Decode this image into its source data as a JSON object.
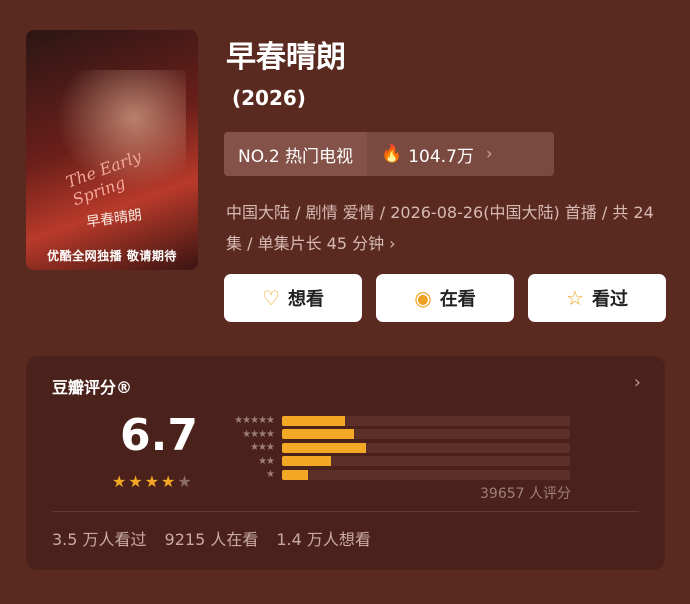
{
  "title": "早春晴朗",
  "year": "(2026)",
  "poster": {
    "art_title": "早春晴朗",
    "art_en": "The Early Spring",
    "tagline": "优酷全网独播 敬请期待"
  },
  "rank": {
    "label": "NO.2 热门电视",
    "heat": "104.7万"
  },
  "meta_text": "中国大陆 / 剧情 爱情 / 2026-08-26(中国大陆) 首播 / 共 24 集 / 单集片长 45 分钟 ›",
  "buttons": [
    {
      "label": "想看",
      "icon": "heart-plus-icon"
    },
    {
      "label": "在看",
      "icon": "target-icon"
    },
    {
      "label": "看过",
      "icon": "star-outline-icon"
    }
  ],
  "rating": {
    "header": "豆瓣评分®",
    "score": "6.7",
    "stars_value": 3.5,
    "distribution": [
      {
        "stars": "★★★★★",
        "fraction": 0.22
      },
      {
        "stars": "★★★★",
        "fraction": 0.25
      },
      {
        "stars": "★★★",
        "fraction": 0.29
      },
      {
        "stars": "★★",
        "fraction": 0.17
      },
      {
        "stars": "★",
        "fraction": 0.09
      }
    ],
    "count": "39657 人评分",
    "stats": [
      "3.5 万人看过",
      "9215 人在看",
      "1.4 万人想看"
    ]
  },
  "colors": {
    "accent": "#f3a926",
    "background": "#5a2a20"
  }
}
